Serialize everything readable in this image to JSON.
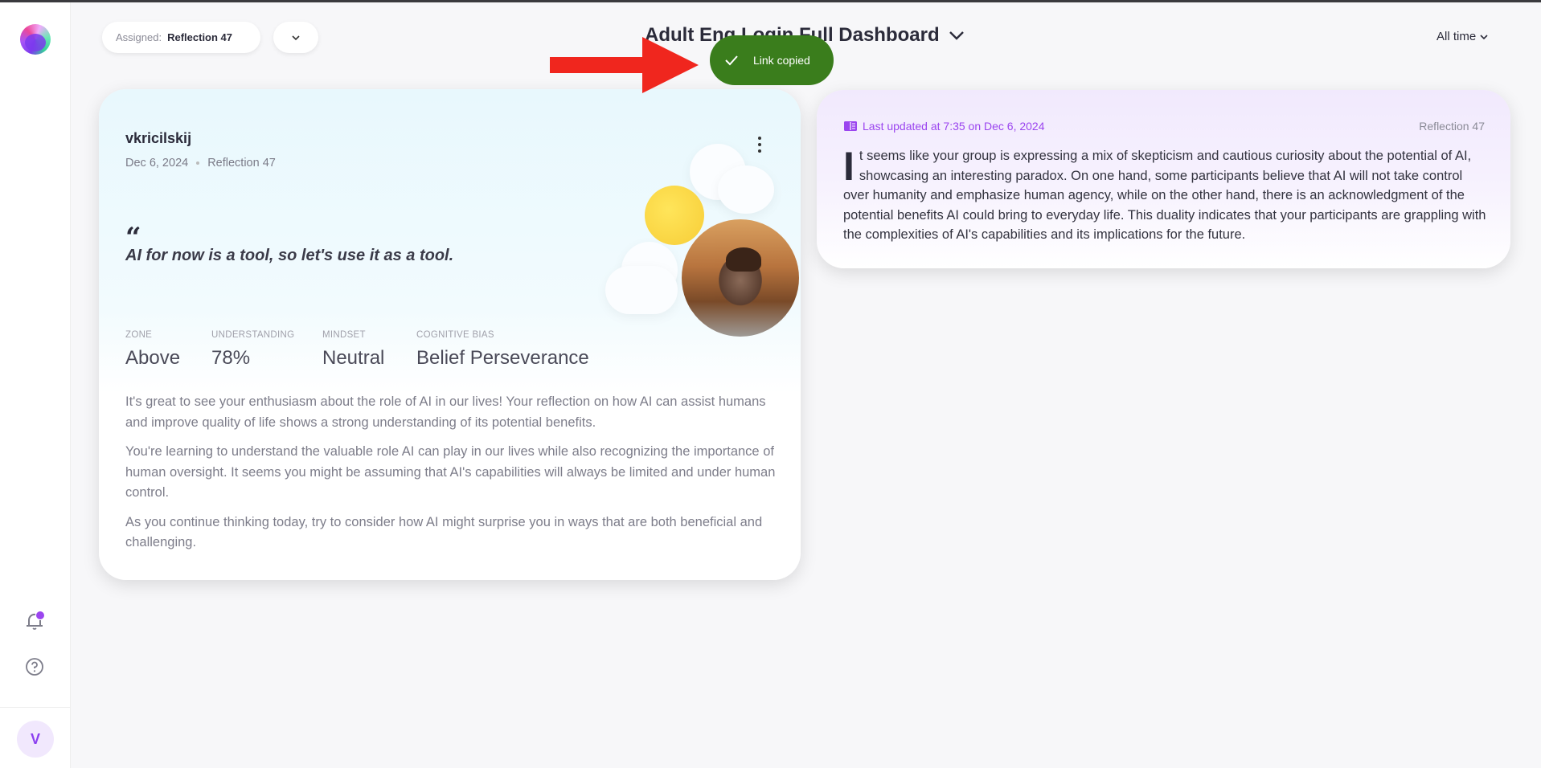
{
  "header": {
    "assigned_label": "Assigned:",
    "assigned_value": "Reflection 47",
    "title": "Adult Eng Login Full Dashboard",
    "time_filter": "All time"
  },
  "toast": {
    "text": "Link copied",
    "color": "#3a7d1c"
  },
  "sidebar": {
    "avatar_initial": "V",
    "notification_dot_color": "#9b45ef"
  },
  "reflection_card": {
    "username": "vkricilskij",
    "date": "Dec 6, 2024",
    "reflection": "Reflection 47",
    "quote": "AI for now is a tool, so let's use it as a tool.",
    "stats": [
      {
        "label": "ZONE",
        "value": "Above"
      },
      {
        "label": "UNDERSTANDING",
        "value": "78%"
      },
      {
        "label": "MINDSET",
        "value": "Neutral"
      },
      {
        "label": "COGNITIVE BIAS",
        "value": "Belief Perseverance"
      }
    ],
    "paragraphs": [
      "It's great to see your enthusiasm about the role of AI in our lives! Your reflection on how AI can assist humans and improve quality of life shows a strong understanding of its potential benefits.",
      "You're learning to understand the valuable role AI can play in our lives while also recognizing the importance of human oversight. It seems you might be assuming that AI's capabilities will always be limited and under human control.",
      "As you continue thinking today, try to consider how AI might surprise you in ways that are both beneficial and challenging."
    ]
  },
  "summary_card": {
    "last_updated": "Last updated at 7:35 on Dec 6, 2024",
    "reflection": "Reflection 47",
    "drop_cap": "I",
    "body": "t seems like your group is expressing a mix of skepticism and cautious curiosity about the potential of AI, showcasing an interesting paradox. On one hand, some participants believe that AI will not take control over humanity and emphasize human agency, while on the other hand, there is an acknowledgment of the potential benefits AI could bring to everyday life. This duality indicates that your participants are grappling with the complexities of AI's capabilities and its implications for the future.",
    "accent": "#9b45ef"
  }
}
